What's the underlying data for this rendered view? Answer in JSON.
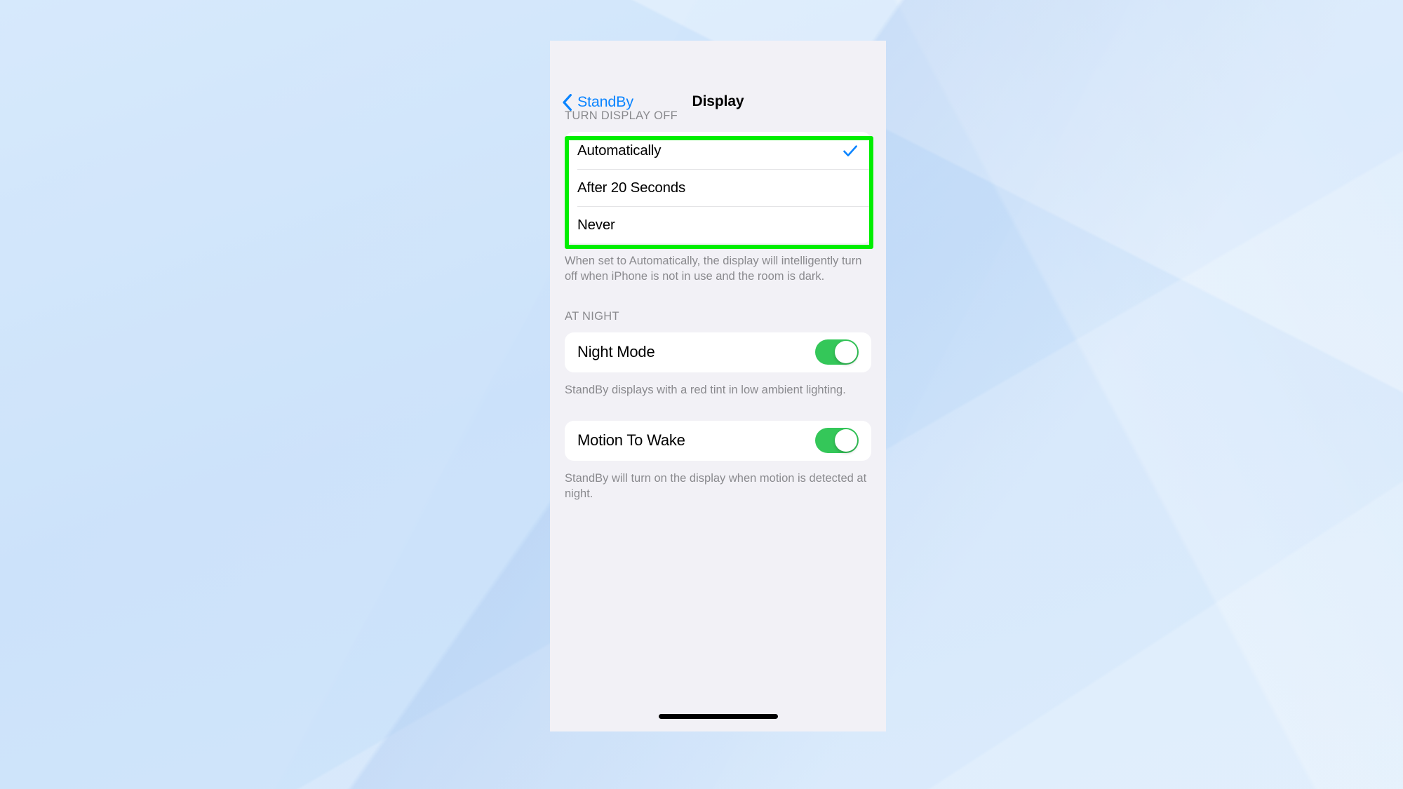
{
  "wallpaper": {
    "base_color": "#bcd4f5"
  },
  "phone": {
    "screen_bg": "#f2f1f6",
    "navbar": {
      "back_label": "StandBy",
      "back_icon": "chevron-left-icon",
      "title": "Display",
      "accent_color": "#0a84ff"
    },
    "sections": [
      {
        "header": "TURN DISPLAY OFF",
        "options": [
          {
            "label": "Automatically",
            "selected": true
          },
          {
            "label": "After 20 Seconds",
            "selected": false
          },
          {
            "label": "Never",
            "selected": false
          }
        ],
        "footer": "When set to Automatically, the display will intelligently turn off when iPhone is not in use and the room is dark."
      },
      {
        "header": "AT NIGHT",
        "toggles": [
          {
            "label": "Night Mode",
            "value": "on",
            "footer": "StandBy displays with a red tint in low ambient lighting."
          },
          {
            "label": "Motion To Wake",
            "value": "on",
            "footer": "StandBy will turn on the display when motion is detected at night."
          }
        ]
      }
    ],
    "home_indicator": true
  },
  "annotation": {
    "highlight_color": "#00ee00",
    "target": "TURN DISPLAY OFF options group"
  },
  "colors": {
    "accent_blue": "#0a84ff",
    "toggle_green": "#34c759",
    "secondary_label": "#8a8a8e",
    "separator": "#e4e4e6",
    "card_bg": "#ffffff"
  }
}
